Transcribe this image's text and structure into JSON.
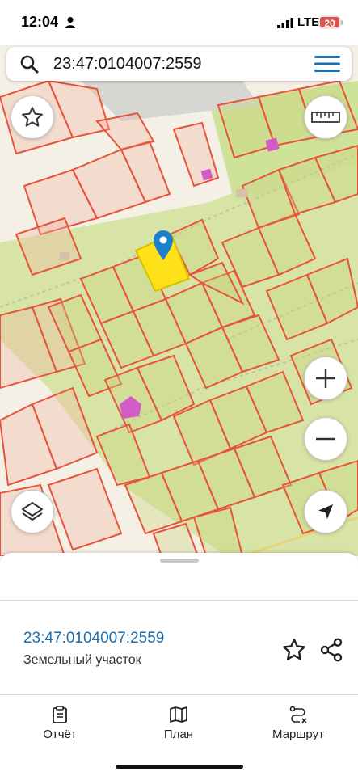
{
  "status_bar": {
    "time": "12:04",
    "network": "LTE",
    "battery": "20"
  },
  "search": {
    "query": "23:47:0104007:2559"
  },
  "map": {
    "icons": [
      "star-icon",
      "ruler-icon",
      "zoom-in-icon",
      "zoom-out-icon",
      "layers-icon",
      "location-arrow-icon",
      "location-pin-icon"
    ],
    "colors": {
      "parcel_border": "#e8523a",
      "selected_parcel": "#ffe11a",
      "pin": "#1d7fd0",
      "building": "#d35bc5"
    }
  },
  "info_card": {
    "cadastral_number": "23:47:0104007:2559",
    "object_type": "Земельный участок"
  },
  "tab_bar": {
    "tabs": [
      {
        "label": "Отчёт",
        "icon": "clipboard-icon"
      },
      {
        "label": "План",
        "icon": "map-icon"
      },
      {
        "label": "Маршрут",
        "icon": "route-icon"
      }
    ]
  }
}
